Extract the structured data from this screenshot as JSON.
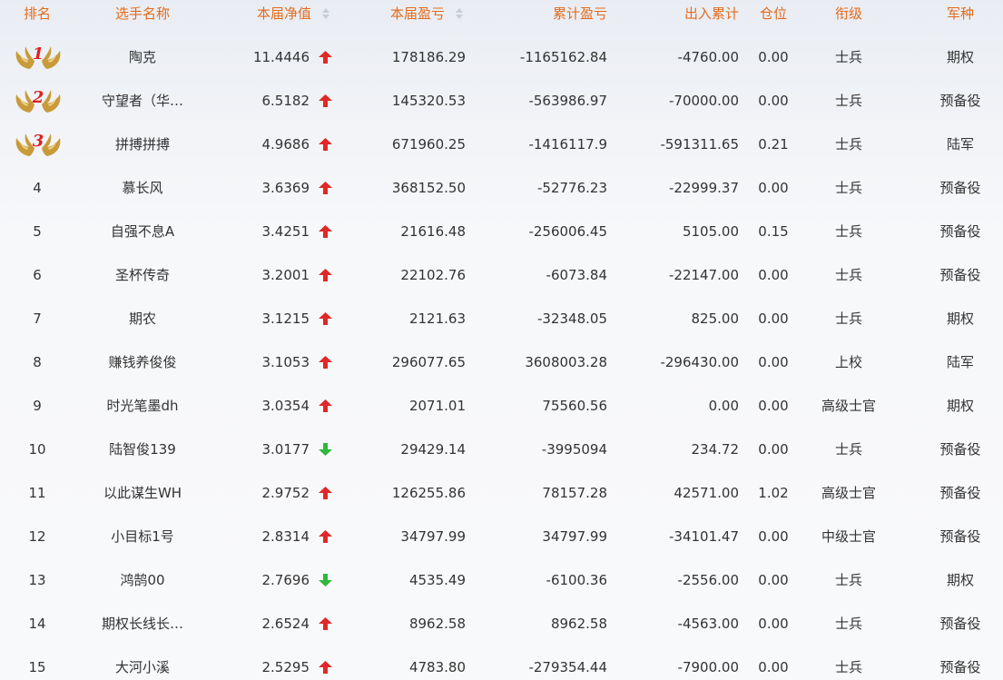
{
  "columns": {
    "rank": "排名",
    "name": "选手名称",
    "nav": "本届净值",
    "profit": "本届盈亏",
    "cumulative": "累计盈亏",
    "flow": "出入累计",
    "position": "仓位",
    "title": "衔级",
    "branch": "军种"
  },
  "colors": {
    "header_text": "#e36b1c",
    "up": "#e02828",
    "down": "#2fb83a",
    "medal_gold": "#c99a3a",
    "medal_number": "#e02020"
  },
  "icons": {
    "sort": "sort-updown-icon",
    "up": "arrow-up-icon",
    "down": "arrow-down-icon",
    "medal": "laurel-wings-medal-icon"
  },
  "rows": [
    {
      "rank": "1",
      "name": "陶克",
      "nav": "11.4446",
      "trend": "up",
      "profit": "178186.29",
      "cumulative": "-1165162.84",
      "flow": "-4760.00",
      "position": "0.00",
      "title": "士兵",
      "branch": "期权"
    },
    {
      "rank": "2",
      "name": "守望者（华…",
      "nav": "6.5182",
      "trend": "up",
      "profit": "145320.53",
      "cumulative": "-563986.97",
      "flow": "-70000.00",
      "position": "0.00",
      "title": "士兵",
      "branch": "预备役"
    },
    {
      "rank": "3",
      "name": "拼搏拼搏",
      "nav": "4.9686",
      "trend": "up",
      "profit": "671960.25",
      "cumulative": "-1416117.9",
      "flow": "-591311.65",
      "position": "0.21",
      "title": "士兵",
      "branch": "陆军"
    },
    {
      "rank": "4",
      "name": "慕长风",
      "nav": "3.6369",
      "trend": "up",
      "profit": "368152.50",
      "cumulative": "-52776.23",
      "flow": "-22999.37",
      "position": "0.00",
      "title": "士兵",
      "branch": "预备役"
    },
    {
      "rank": "5",
      "name": "自强不息A",
      "nav": "3.4251",
      "trend": "up",
      "profit": "21616.48",
      "cumulative": "-256006.45",
      "flow": "5105.00",
      "position": "0.15",
      "title": "士兵",
      "branch": "预备役"
    },
    {
      "rank": "6",
      "name": "圣杯传奇",
      "nav": "3.2001",
      "trend": "up",
      "profit": "22102.76",
      "cumulative": "-6073.84",
      "flow": "-22147.00",
      "position": "0.00",
      "title": "士兵",
      "branch": "预备役"
    },
    {
      "rank": "7",
      "name": "期农",
      "nav": "3.1215",
      "trend": "up",
      "profit": "2121.63",
      "cumulative": "-32348.05",
      "flow": "825.00",
      "position": "0.00",
      "title": "士兵",
      "branch": "期权"
    },
    {
      "rank": "8",
      "name": "赚钱养俊俊",
      "nav": "3.1053",
      "trend": "up",
      "profit": "296077.65",
      "cumulative": "3608003.28",
      "flow": "-296430.00",
      "position": "0.00",
      "title": "上校",
      "branch": "陆军"
    },
    {
      "rank": "9",
      "name": "时光笔墨dh",
      "nav": "3.0354",
      "trend": "up",
      "profit": "2071.01",
      "cumulative": "75560.56",
      "flow": "0.00",
      "position": "0.00",
      "title": "高级士官",
      "branch": "期权"
    },
    {
      "rank": "10",
      "name": "陆智俊139",
      "nav": "3.0177",
      "trend": "down",
      "profit": "29429.14",
      "cumulative": "-3995094",
      "flow": "234.72",
      "position": "0.00",
      "title": "士兵",
      "branch": "预备役"
    },
    {
      "rank": "11",
      "name": "以此谋生WH",
      "nav": "2.9752",
      "trend": "up",
      "profit": "126255.86",
      "cumulative": "78157.28",
      "flow": "42571.00",
      "position": "1.02",
      "title": "高级士官",
      "branch": "预备役"
    },
    {
      "rank": "12",
      "name": "小目标1号",
      "nav": "2.8314",
      "trend": "up",
      "profit": "34797.99",
      "cumulative": "34797.99",
      "flow": "-34101.47",
      "position": "0.00",
      "title": "中级士官",
      "branch": "预备役"
    },
    {
      "rank": "13",
      "name": "鸿鹄00",
      "nav": "2.7696",
      "trend": "down",
      "profit": "4535.49",
      "cumulative": "-6100.36",
      "flow": "-2556.00",
      "position": "0.00",
      "title": "士兵",
      "branch": "期权"
    },
    {
      "rank": "14",
      "name": "期权长线长…",
      "nav": "2.6524",
      "trend": "up",
      "profit": "8962.58",
      "cumulative": "8962.58",
      "flow": "-4563.00",
      "position": "0.00",
      "title": "士兵",
      "branch": "预备役"
    },
    {
      "rank": "15",
      "name": "大河小溪",
      "nav": "2.5295",
      "trend": "up",
      "profit": "4783.80",
      "cumulative": "-279354.44",
      "flow": "-7900.00",
      "position": "0.00",
      "title": "士兵",
      "branch": "预备役"
    }
  ]
}
